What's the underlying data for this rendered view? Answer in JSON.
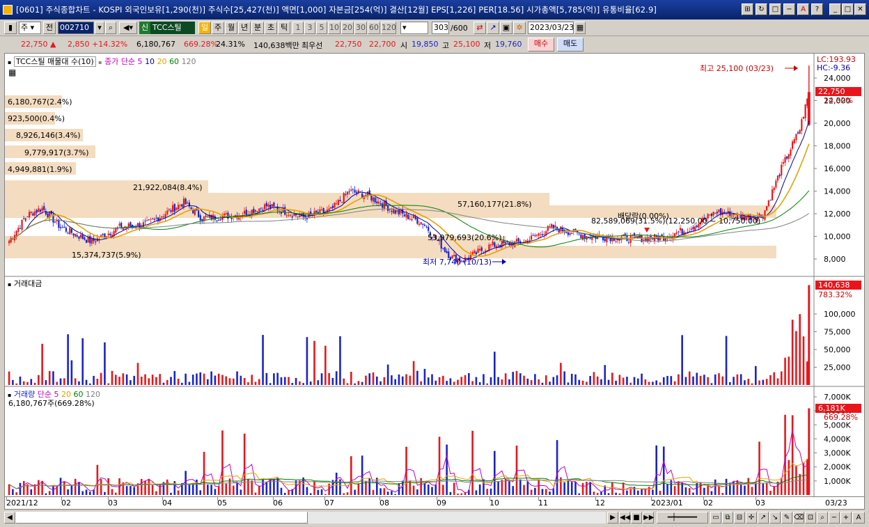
{
  "window": {
    "title": "[0601] 주식종합차트 - KOSPI 외국인보유[1,290(천)] 주식수[25,427(천)] 액면[1,000] 자본금[254(억)] 결산[12월] EPS[1,226] PER[18.56] 시가총액[5,785(억)] 유통비율[62.9]"
  },
  "toolbar": {
    "market": "주",
    "all": "전",
    "code": "002710",
    "badge": "신",
    "stock_name": "TCC스틸",
    "periods": [
      "일",
      "주",
      "월",
      "년",
      "분",
      "초",
      "틱"
    ],
    "active_period": "일",
    "minutes": [
      "1",
      "3",
      "5",
      "10",
      "20",
      "30",
      "60",
      "120"
    ],
    "count": "303",
    "count_max": "/600",
    "date": "2023/03/23"
  },
  "quote": {
    "price": "22,750",
    "arrow": "▲",
    "change": "2,850",
    "change_pct": "+14.32%",
    "volume": "6,180,767",
    "volume_ratio": "669.28%",
    "turnover": "24.31%",
    "amount": "140,638백만",
    "best_label": "최우선",
    "best_ask": "22,750",
    "best_bid": "22,700",
    "open_label": "시",
    "open": "19,850",
    "high_label": "고",
    "high": "25,100",
    "low_label": "저",
    "low": "19,760",
    "buy": "매수",
    "sell": "매도"
  },
  "price_panel": {
    "legend_name": "TCC스틸 매물대 수(10)",
    "ma_label": "종가 단순 5",
    "ma_periods": [
      "10",
      "20",
      "60",
      "120"
    ],
    "lc": "LC:193.93",
    "hc": "HC:-9.36",
    "current_price": "22,750",
    "current_pct": "14.32%",
    "high_note": "최고 25,100 (03/23)",
    "low_note": "최저 7,740 (10/13)",
    "dividend_note": "배당락(0.00%)",
    "profile": [
      "6,180,767(2.4%)",
      "923,500(0.4%)",
      "8,926,146(3.4%)",
      "9,779,917(3.7%)",
      "4,949,881(1.9%)",
      "21,922,084(8.4%)",
      "57,160,177(21.8%)",
      "53,979,693(20.6%)",
      "15,374,737(5.9%)",
      "82,589,069(31.5%)(12,250.00 ~ 10,750.00)"
    ],
    "y_ticks": [
      "24,000",
      "22,000",
      "20,000",
      "18,000",
      "16,000",
      "14,000",
      "12,000",
      "10,000",
      "8,000"
    ]
  },
  "amount_panel": {
    "legend": "거래대금",
    "current": "140,638",
    "current_pct": "783.32%",
    "y_ticks": [
      "100,000",
      "75,000",
      "50,000",
      "25,000"
    ]
  },
  "volume_panel": {
    "legend_name": "거래량",
    "ma_label": "단순 5",
    "ma_periods": [
      "20",
      "60",
      "120"
    ],
    "sub": "6,180,767주(669.28%)",
    "current": "6,181K",
    "current_pct": "669.28%",
    "y_ticks": [
      "7,000K",
      "6,000K",
      "5,000K",
      "4,000K",
      "3,000K",
      "2,000K",
      "1,000K"
    ]
  },
  "x_axis": {
    "labels": [
      "2021/12",
      "02",
      "03",
      "04",
      "05",
      "06",
      "07",
      "08",
      "09",
      "10",
      "11",
      "12",
      "2023/01",
      "02",
      "03"
    ],
    "last": "03/23"
  },
  "colors": {
    "up": "#e8161b",
    "down": "#1a23c8",
    "ma5": "#c000c0",
    "ma10": "#0000a0",
    "ma20": "#e8a000",
    "ma60": "#008000",
    "ma120": "#808080",
    "profile": "#f3dcc0"
  }
}
